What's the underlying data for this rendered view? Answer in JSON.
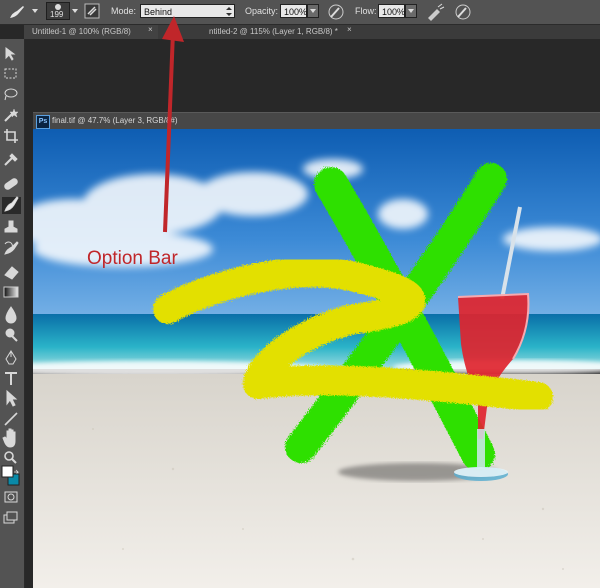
{
  "options_bar": {
    "brush_size": "199",
    "mode_label": "Mode:",
    "mode_value": "Behind",
    "opacity_label": "Opacity:",
    "opacity_value": "100%",
    "flow_label": "Flow:",
    "flow_value": "100%"
  },
  "tabs": [
    {
      "label": "Untitled-1 @ 100% (RGB/8)",
      "close": "×"
    },
    {
      "label": "ntitled-2 @ 115% (Layer 1, RGB/8) *",
      "close": "×"
    }
  ],
  "document": {
    "badge": "Ps",
    "title": "final.tif @ 47.7% (Layer 3, RGB/8#)"
  },
  "annotation": {
    "text": "Option Bar",
    "color": "#c0262a"
  },
  "colors": {
    "ui_dark": "#535353",
    "panel_bg": "#282828",
    "stroke_yellow": "#e3e000",
    "stroke_green": "#2fe000",
    "drink_red": "#e0242e"
  },
  "tools": [
    "move-tool",
    "marquee-tool",
    "lasso-tool",
    "magic-wand-tool",
    "crop-tool",
    "eyedropper-tool",
    "healing-brush-tool",
    "brush-tool",
    "clone-stamp-tool",
    "history-brush-tool",
    "eraser-tool",
    "gradient-tool",
    "blur-tool",
    "dodge-tool",
    "pen-tool",
    "type-tool",
    "path-selection-tool",
    "line-tool",
    "hand-tool",
    "zoom-tool"
  ]
}
